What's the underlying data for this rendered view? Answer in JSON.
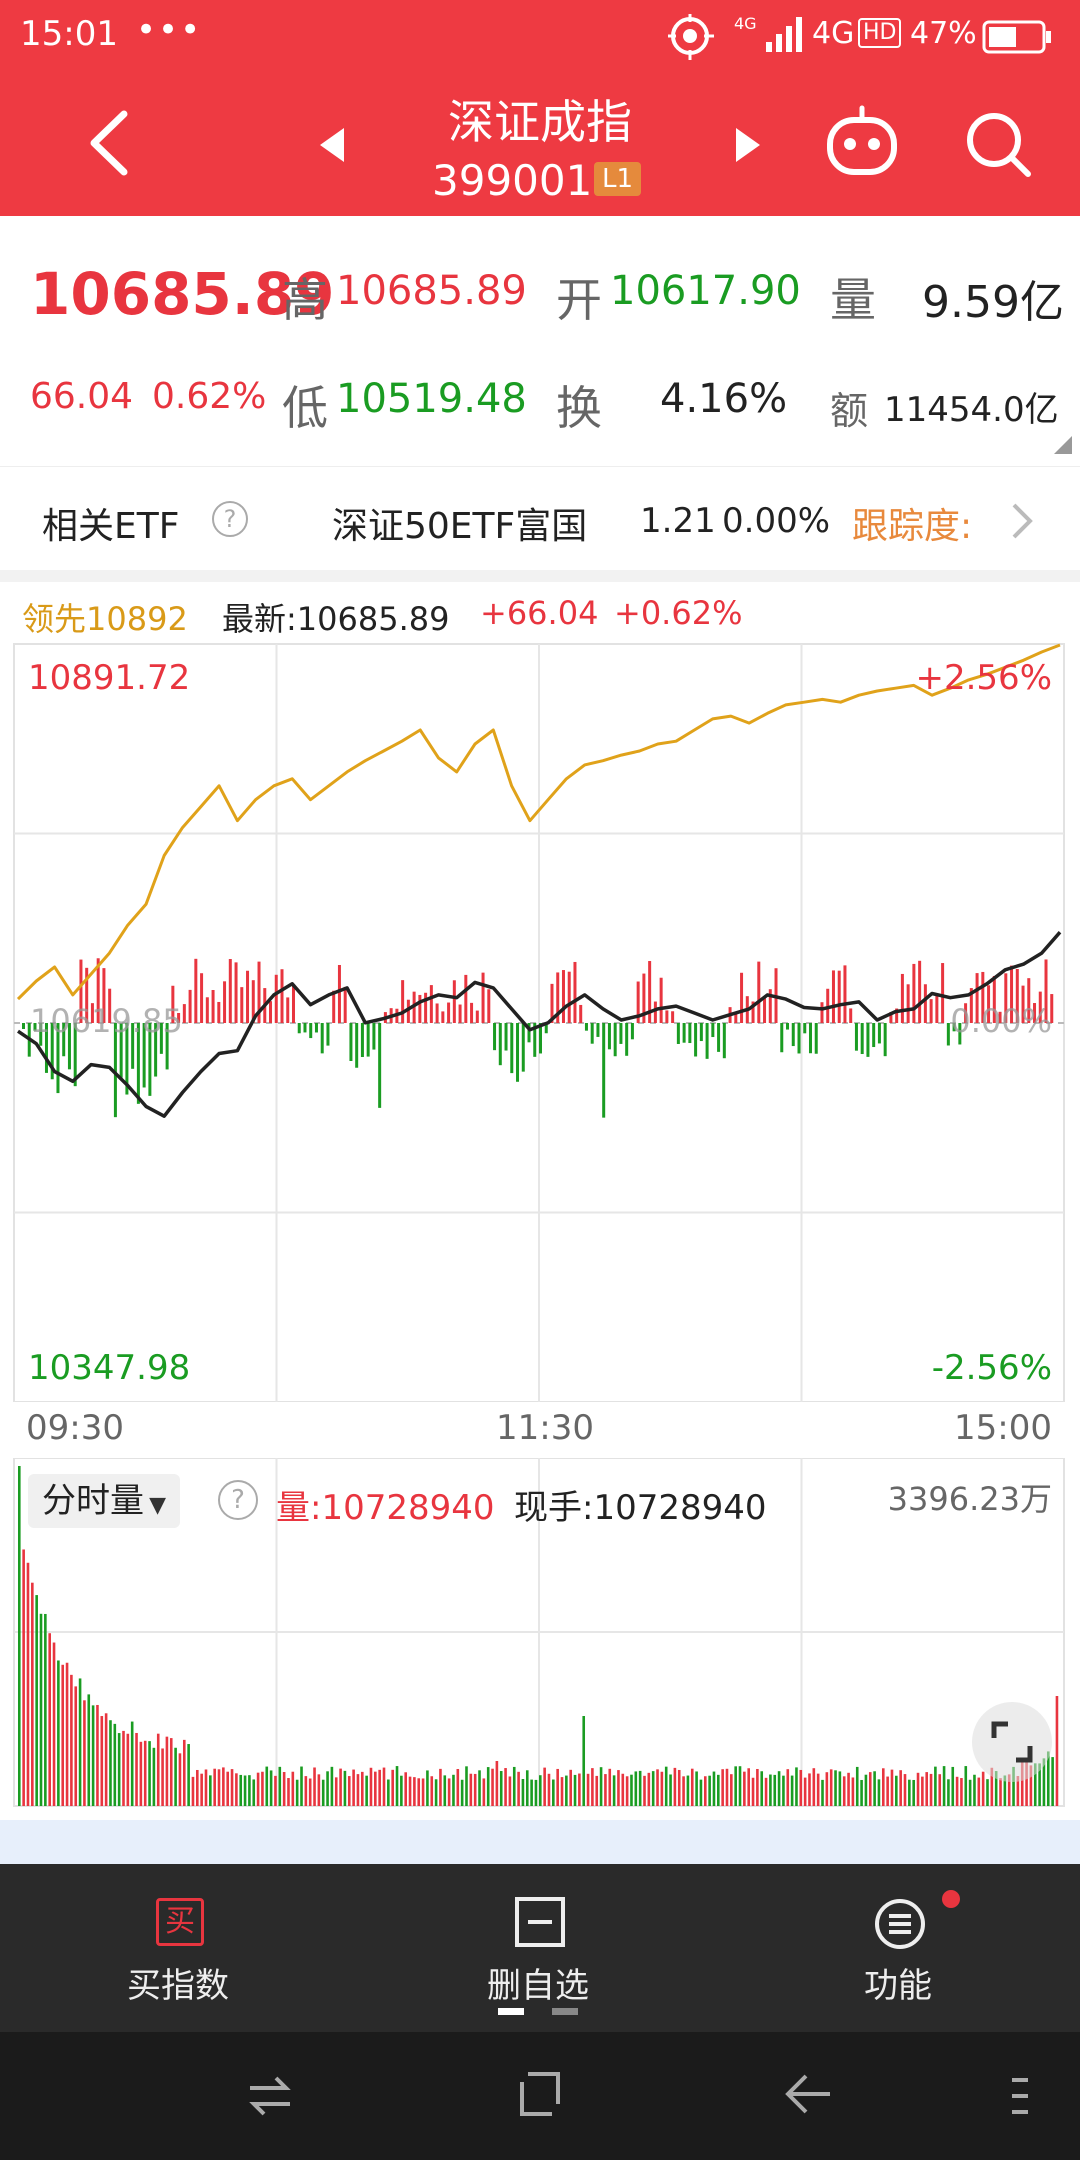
{
  "status_bar": {
    "time": "15:01",
    "dots": "•••",
    "network": "4G",
    "battery_percent": "47%",
    "hd": "HD",
    "net_small": "4G"
  },
  "header": {
    "title": "深证成指",
    "code": "399001",
    "badge": "L1"
  },
  "quote": {
    "last": "10685.89",
    "change": "66.04",
    "change_pct": "0.62%",
    "high_label": "高",
    "high": "10685.89",
    "open_label": "开",
    "open": "10617.90",
    "vol_label": "量",
    "vol": "9.59亿",
    "low_label": "低",
    "low": "10519.48",
    "turn_label": "换",
    "turn": "4.16%",
    "amt_label": "额",
    "amt": "11454.0亿"
  },
  "etf": {
    "label": "相关ETF",
    "help": "?",
    "name": "深证50ETF富国",
    "price": "1.21",
    "pct": "0.00%",
    "track": "跟踪度:"
  },
  "chart_data": {
    "type": "line",
    "legend_lead": "领先10892",
    "legend_latest": "最新:10685.89",
    "legend_change": "+66.04",
    "legend_pct": "+0.62%",
    "y_top": "10891.72",
    "y_mid": "10619.85",
    "y_bottom": "10347.98",
    "pct_top": "+2.56%",
    "pct_mid": "0.00%",
    "pct_bottom": "-2.56%",
    "ylim": [
      10347.98,
      10891.72
    ],
    "x_ticks": [
      "09:30",
      "11:30",
      "15:00"
    ],
    "series": [
      {
        "name": "领先",
        "color": "#e0a21a",
        "values": [
          10637,
          10650,
          10660,
          10640,
          10655,
          10670,
          10690,
          10705,
          10740,
          10760,
          10775,
          10790,
          10765,
          10780,
          10790,
          10795,
          10780,
          10790,
          10800,
          10808,
          10815,
          10822,
          10830,
          10810,
          10800,
          10820,
          10830,
          10790,
          10765,
          10780,
          10795,
          10805,
          10808,
          10812,
          10815,
          10820,
          10822,
          10830,
          10838,
          10840,
          10835,
          10842,
          10848,
          10850,
          10852,
          10850,
          10855,
          10858,
          10860,
          10862,
          10855,
          10860,
          10866,
          10870,
          10875,
          10880,
          10886,
          10891
        ]
      },
      {
        "name": "最新",
        "color": "#222222",
        "values": [
          10614,
          10605,
          10585,
          10578,
          10590,
          10588,
          10575,
          10560,
          10553,
          10570,
          10585,
          10598,
          10600,
          10625,
          10640,
          10648,
          10633,
          10640,
          10645,
          10620,
          10623,
          10627,
          10635,
          10640,
          10638,
          10649,
          10645,
          10630,
          10615,
          10620,
          10632,
          10640,
          10630,
          10622,
          10625,
          10630,
          10632,
          10627,
          10622,
          10626,
          10630,
          10640,
          10637,
          10631,
          10630,
          10633,
          10635,
          10622,
          10628,
          10630,
          10641,
          10638,
          10640,
          10648,
          10658,
          10662,
          10670,
          10685
        ]
      }
    ]
  },
  "volume": {
    "selector": "分时量",
    "help": "?",
    "vol_label": "量:10728940",
    "now_label": "现手:10728940",
    "max_label": "3396.23万"
  },
  "bottom_nav": {
    "buy": "买指数",
    "buy_icon_char": "买",
    "delete": "删自选",
    "func": "功能"
  },
  "banner_text": ""
}
